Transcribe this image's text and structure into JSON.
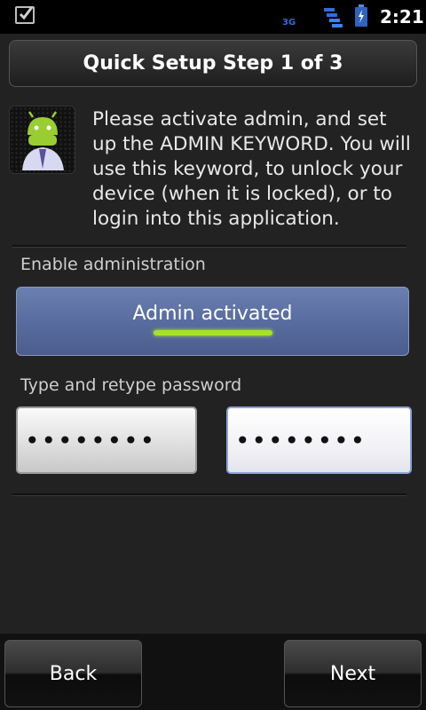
{
  "status_bar": {
    "network": "3G",
    "time": "2:21",
    "icons": [
      "notification-checkbox-icon",
      "signal-icon",
      "battery-charging-icon"
    ]
  },
  "header": {
    "title": "Quick Setup Step 1 of 3"
  },
  "intro": {
    "icon": "android-admin-icon",
    "text": "Please activate admin, and set up the ADMIN KEYWORD. You will use this keyword, to unlock your device (when it is locked), or to login into this application."
  },
  "admin_section": {
    "label": "Enable administration",
    "button_label": "Admin activated",
    "active": true
  },
  "password_section": {
    "label": "Type and retype password",
    "password_masked": "••••••••",
    "retype_masked": "••••••••"
  },
  "footer": {
    "back_label": "Back",
    "next_label": "Next"
  },
  "colors": {
    "accent_green": "#a6e22a",
    "admin_button_blue": "#5b6ea1",
    "background": "#222222"
  }
}
